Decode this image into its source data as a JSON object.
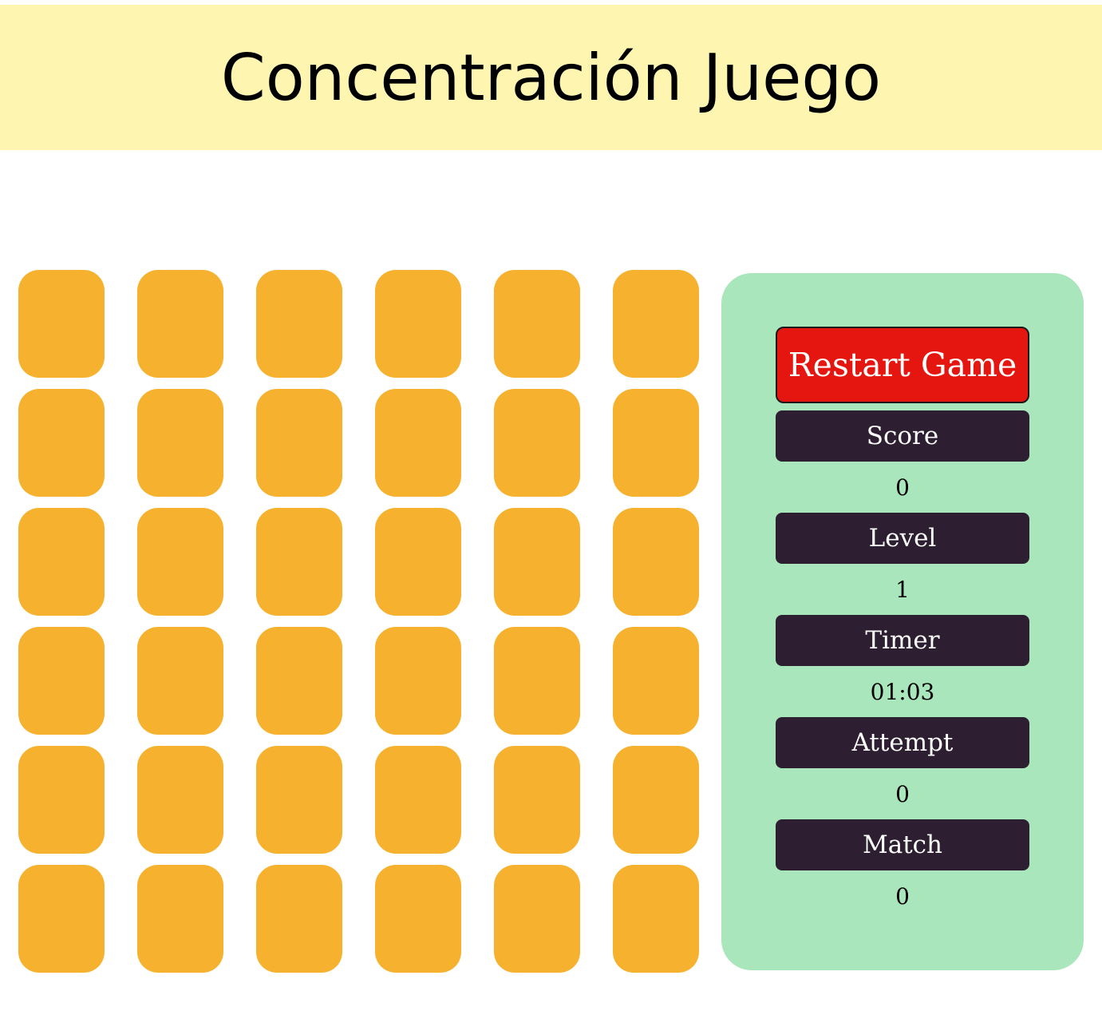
{
  "header": {
    "title": "Concentración Juego"
  },
  "board": {
    "rows": 6,
    "columns": 6,
    "card_color": "#f6b22e"
  },
  "panel": {
    "restart_label": "Restart Game",
    "stats": [
      {
        "label": "Score",
        "value": "0"
      },
      {
        "label": "Level",
        "value": "1"
      },
      {
        "label": "Timer",
        "value": "01:03"
      },
      {
        "label": "Attempt",
        "value": "0"
      },
      {
        "label": "Match",
        "value": "0"
      }
    ]
  },
  "colors": {
    "header_bg": "#fdf5b0",
    "panel_bg": "#a9e6bc",
    "restart_bg": "#e5150f",
    "label_bg": "#2d1f31"
  }
}
